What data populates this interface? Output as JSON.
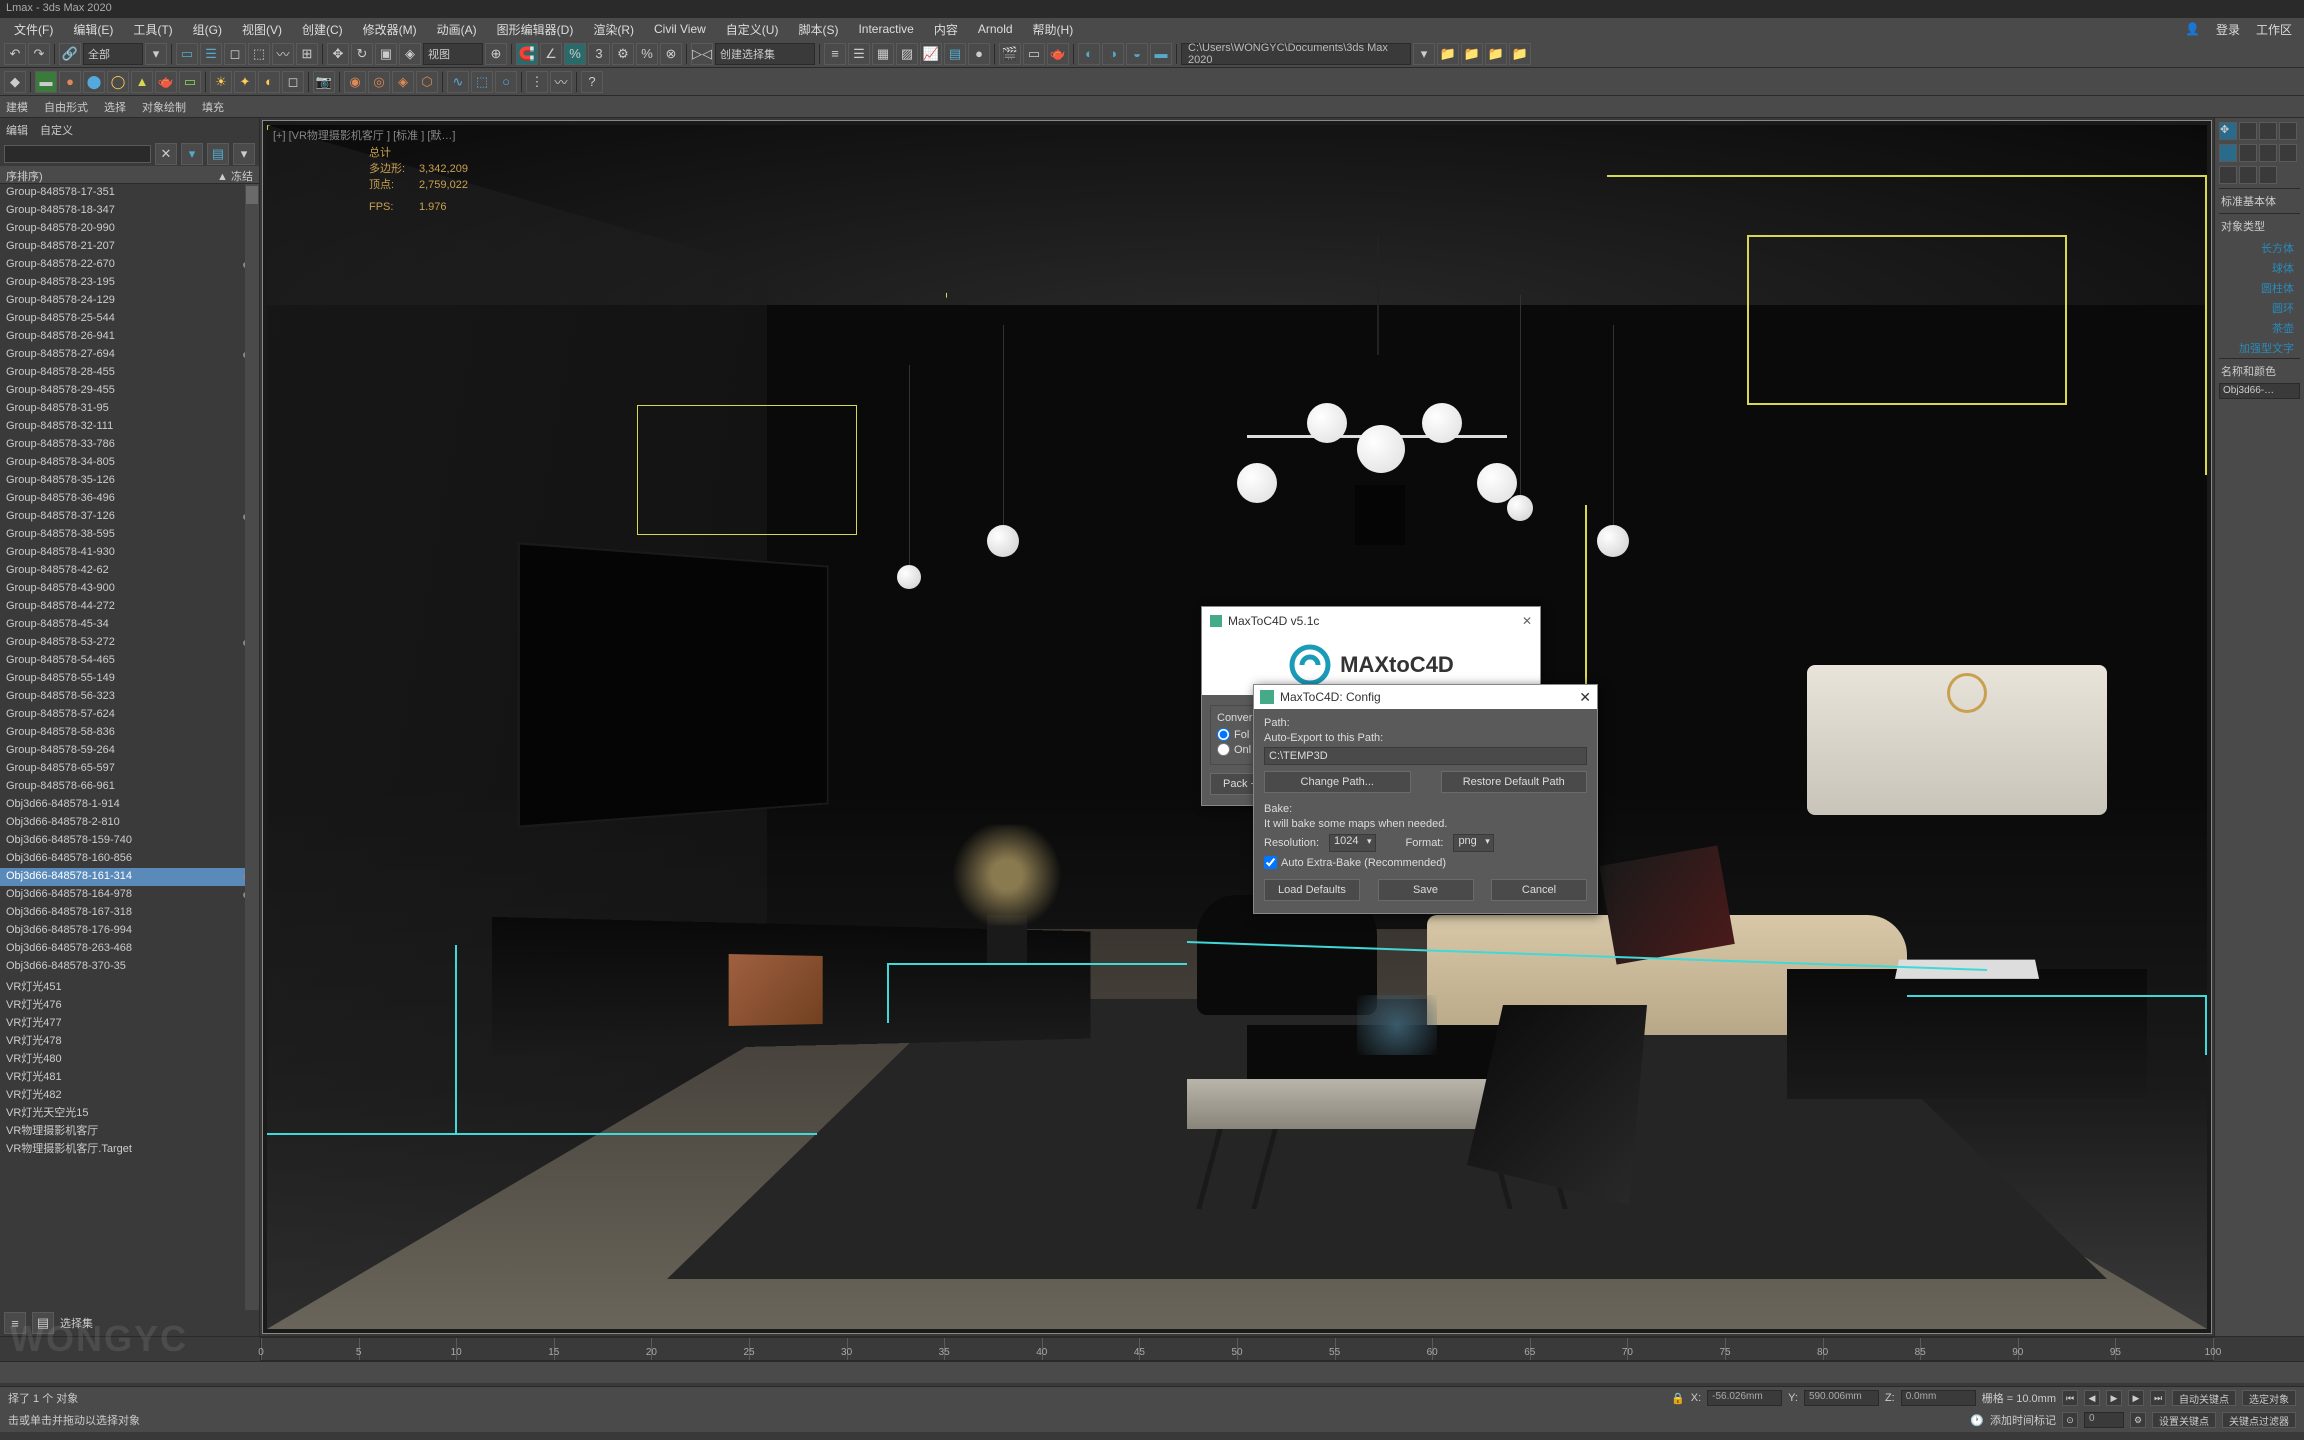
{
  "title": "Lmax - 3ds Max 2020",
  "menu": {
    "items": [
      "文件(F)",
      "编辑(E)",
      "工具(T)",
      "组(G)",
      "视图(V)",
      "创建(C)",
      "修改器(M)",
      "动画(A)",
      "图形编辑器(D)",
      "渲染(R)",
      "Civil View",
      "自定义(U)",
      "脚本(S)",
      "Interactive",
      "内容",
      "Arnold",
      "帮助(H)"
    ],
    "login": "登录",
    "workspace": "工作区"
  },
  "toolbar": {
    "dropdown1": "全部",
    "dropdown2": "视图",
    "dropdown3": "创建选择集",
    "path": "C:\\Users\\WONGYC\\Documents\\3ds Max 2020"
  },
  "subtoolbar": {
    "items": [
      "建模",
      "自由形式",
      "选择",
      "对象绘制",
      "填充"
    ]
  },
  "leftpanel": {
    "tabs": [
      "编辑",
      "自定义"
    ],
    "header_l": "序排序)",
    "header_r": "▲ 冻结",
    "select_label": "选择集",
    "items": [
      "Group-848578-17-351",
      "Group-848578-18-347",
      "Group-848578-20-990",
      "Group-848578-21-207",
      "Group-848578-22-670",
      "Group-848578-23-195",
      "Group-848578-24-129",
      "Group-848578-25-544",
      "Group-848578-26-941",
      "Group-848578-27-694",
      "Group-848578-28-455",
      "Group-848578-29-455",
      "Group-848578-31-95",
      "Group-848578-32-111",
      "Group-848578-33-786",
      "Group-848578-34-805",
      "Group-848578-35-126",
      "Group-848578-36-496",
      "Group-848578-37-126",
      "Group-848578-38-595",
      "Group-848578-41-930",
      "Group-848578-42-62",
      "Group-848578-43-900",
      "Group-848578-44-272",
      "Group-848578-45-34",
      "Group-848578-53-272",
      "Group-848578-54-465",
      "Group-848578-55-149",
      "Group-848578-56-323",
      "Group-848578-57-624",
      "Group-848578-58-836",
      "Group-848578-59-264",
      "Group-848578-65-597",
      "Group-848578-66-961",
      "Obj3d66-848578-1-914",
      "Obj3d66-848578-2-810",
      "Obj3d66-848578-159-740",
      "Obj3d66-848578-160-856",
      "Obj3d66-848578-161-314",
      "Obj3d66-848578-164-978",
      "Obj3d66-848578-167-318",
      "Obj3d66-848578-176-994",
      "Obj3d66-848578-263-468",
      "Obj3d66-848578-370-35",
      "VR灯光451",
      "VR灯光476",
      "VR灯光477",
      "VR灯光478",
      "VR灯光480",
      "VR灯光481",
      "VR灯光482",
      "VR灯光天空光15",
      "VR物理摄影机客厅",
      "VR物理摄影机客厅.Target"
    ],
    "selected": 38
  },
  "viewport": {
    "label": "[+] [VR物理摄影机客厅 ] [标准 ] [默…]",
    "stats": {
      "total_label": "总计",
      "poly_label": "多边形:",
      "poly": "3,342,209",
      "vert_label": "顶点:",
      "vert": "2,759,022",
      "fps_label": "FPS:",
      "fps": "1.976"
    }
  },
  "rightpanel": {
    "sec1": "标准基本体",
    "sec2": "对象类型",
    "types": [
      "长方体",
      "球体",
      "圆柱体",
      "圆环",
      "茶壶",
      "加强型文字"
    ],
    "sec3": "名称和颜色",
    "name_value": "Obj3d66-…"
  },
  "dialog1": {
    "title": "MaxToC4D v5.1c",
    "brand": "MAXtoC4D",
    "grp1": "Convers",
    "radio1": "Fol",
    "radio2": "Onl",
    "btn": "Pack +"
  },
  "dialog2": {
    "title": "MaxToC4D: Config",
    "path_label": "Path:",
    "auto_label": "Auto-Export to this Path:",
    "path_value": "C:\\TEMP3D",
    "btn_change": "Change Path...",
    "btn_restore": "Restore Default Path",
    "bake_label": "Bake:",
    "bake_desc": "It will bake some maps when needed.",
    "res_label": "Resolution:",
    "res_value": "1024",
    "fmt_label": "Format:",
    "fmt_value": "png",
    "check_label": "Auto Extra-Bake (Recommended)",
    "btn_load": "Load Defaults",
    "btn_save": "Save",
    "btn_cancel": "Cancel"
  },
  "timeline": {
    "ticks": [
      0,
      5,
      10,
      15,
      20,
      25,
      30,
      35,
      40,
      45,
      50,
      55,
      60,
      65,
      70,
      75,
      80,
      85,
      90,
      95,
      100
    ]
  },
  "status": {
    "selected": "择了 1 个 对象",
    "hint": "击或单击并拖动以选择对象",
    "grid": "栅格 = 10.0mm",
    "x": "-56.026mm",
    "y": "590.006mm",
    "z": "0.0mm",
    "add_time": "添加时间标记",
    "autokey": "自动关键点",
    "selkey": "选定对象",
    "setkey": "设置关键点",
    "keyfilter": "关键点过滤器"
  },
  "watermark": "WONGYC"
}
